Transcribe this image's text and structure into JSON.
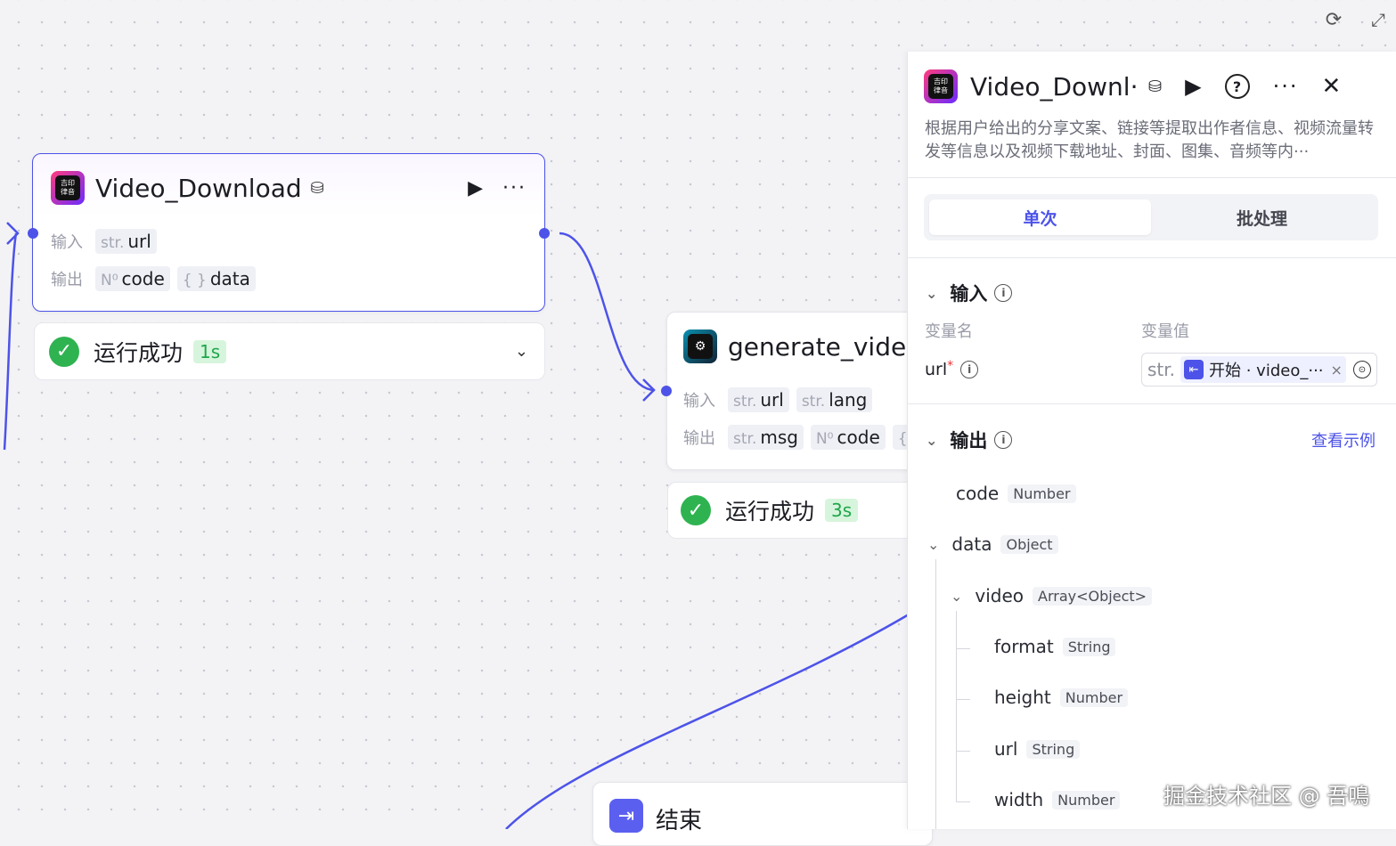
{
  "canvas": {
    "node1": {
      "title": "Video_Download",
      "input_label": "输入",
      "output_label": "输出",
      "inputs": [
        {
          "type": "str.",
          "name": "url"
        }
      ],
      "outputs": [
        {
          "type": "N⁰",
          "name": "code"
        },
        {
          "type": "{ }",
          "name": "data"
        }
      ],
      "status": "运行成功",
      "duration": "1s"
    },
    "node2": {
      "title": "generate_video_",
      "input_label": "输入",
      "output_label": "输出",
      "inputs": [
        {
          "type": "str.",
          "name": "url"
        },
        {
          "type": "str.",
          "name": "lang"
        }
      ],
      "outputs": [
        {
          "type": "str.",
          "name": "msg"
        },
        {
          "type": "N⁰",
          "name": "code"
        },
        {
          "type": "{",
          "name": ""
        }
      ],
      "status": "运行成功",
      "duration": "3s"
    },
    "end_node": {
      "title": "结束"
    },
    "icon_app": "app-logo-icon",
    "icon_app_text": "吉印\n律音"
  },
  "panel": {
    "title": "Video_Downl···",
    "description": "根据用户给出的分享文案、链接等提取出作者信息、视频流量转发等信息以及视频下载地址、封面、图集、音频等内···",
    "tabs": [
      "单次",
      "批处理"
    ],
    "input_section": "输入",
    "col_name": "变量名",
    "col_value": "变量值",
    "var_name": "url",
    "required_mark": "*",
    "value_type": "str.",
    "value_ref": "开始 · video_···",
    "clear_x": "×",
    "output_section": "输出",
    "view_example": "查看示例",
    "outputs": [
      {
        "name": "code",
        "type": "Number"
      },
      {
        "name": "data",
        "type": "Object"
      },
      {
        "name": "video",
        "type": "Array<Object>"
      },
      {
        "name": "format",
        "type": "String"
      },
      {
        "name": "height",
        "type": "Number"
      },
      {
        "name": "url",
        "type": "String"
      },
      {
        "name": "width",
        "type": "Number"
      }
    ]
  },
  "watermark": "掘金技术社区 @ 吾鳴",
  "colors": {
    "accent": "#4d53e8",
    "success": "#2fb351"
  }
}
